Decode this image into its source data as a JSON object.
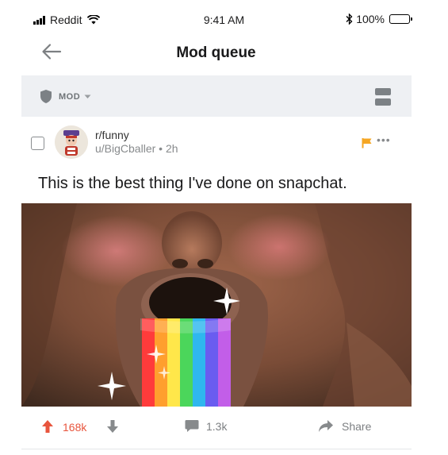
{
  "status_bar": {
    "carrier": "Reddit",
    "time": "9:41 AM",
    "battery": "100%"
  },
  "nav": {
    "title": "Mod queue"
  },
  "mod_bar": {
    "filter_label": "MOD"
  },
  "post": {
    "subreddit": "r/funny",
    "author": "u/BigCballer",
    "separator": "•",
    "age": "2h",
    "more_label": "•••",
    "title": "This is the best thing I've done on snapchat.",
    "score": "168k",
    "comments": "1.3k",
    "share_label": "Share"
  },
  "colors": {
    "upvote": "#e8553d",
    "flag": "#f5a623",
    "mod_bar_bg": "#eef0f3"
  },
  "icons": [
    "signal-icon",
    "wifi-icon",
    "bluetooth-icon",
    "battery-icon",
    "back-arrow-icon",
    "shield-icon",
    "chevron-down-icon",
    "card-view-icon",
    "avatar",
    "flag-icon",
    "more-icon",
    "upvote-icon",
    "downvote-icon",
    "comment-icon",
    "share-icon"
  ]
}
